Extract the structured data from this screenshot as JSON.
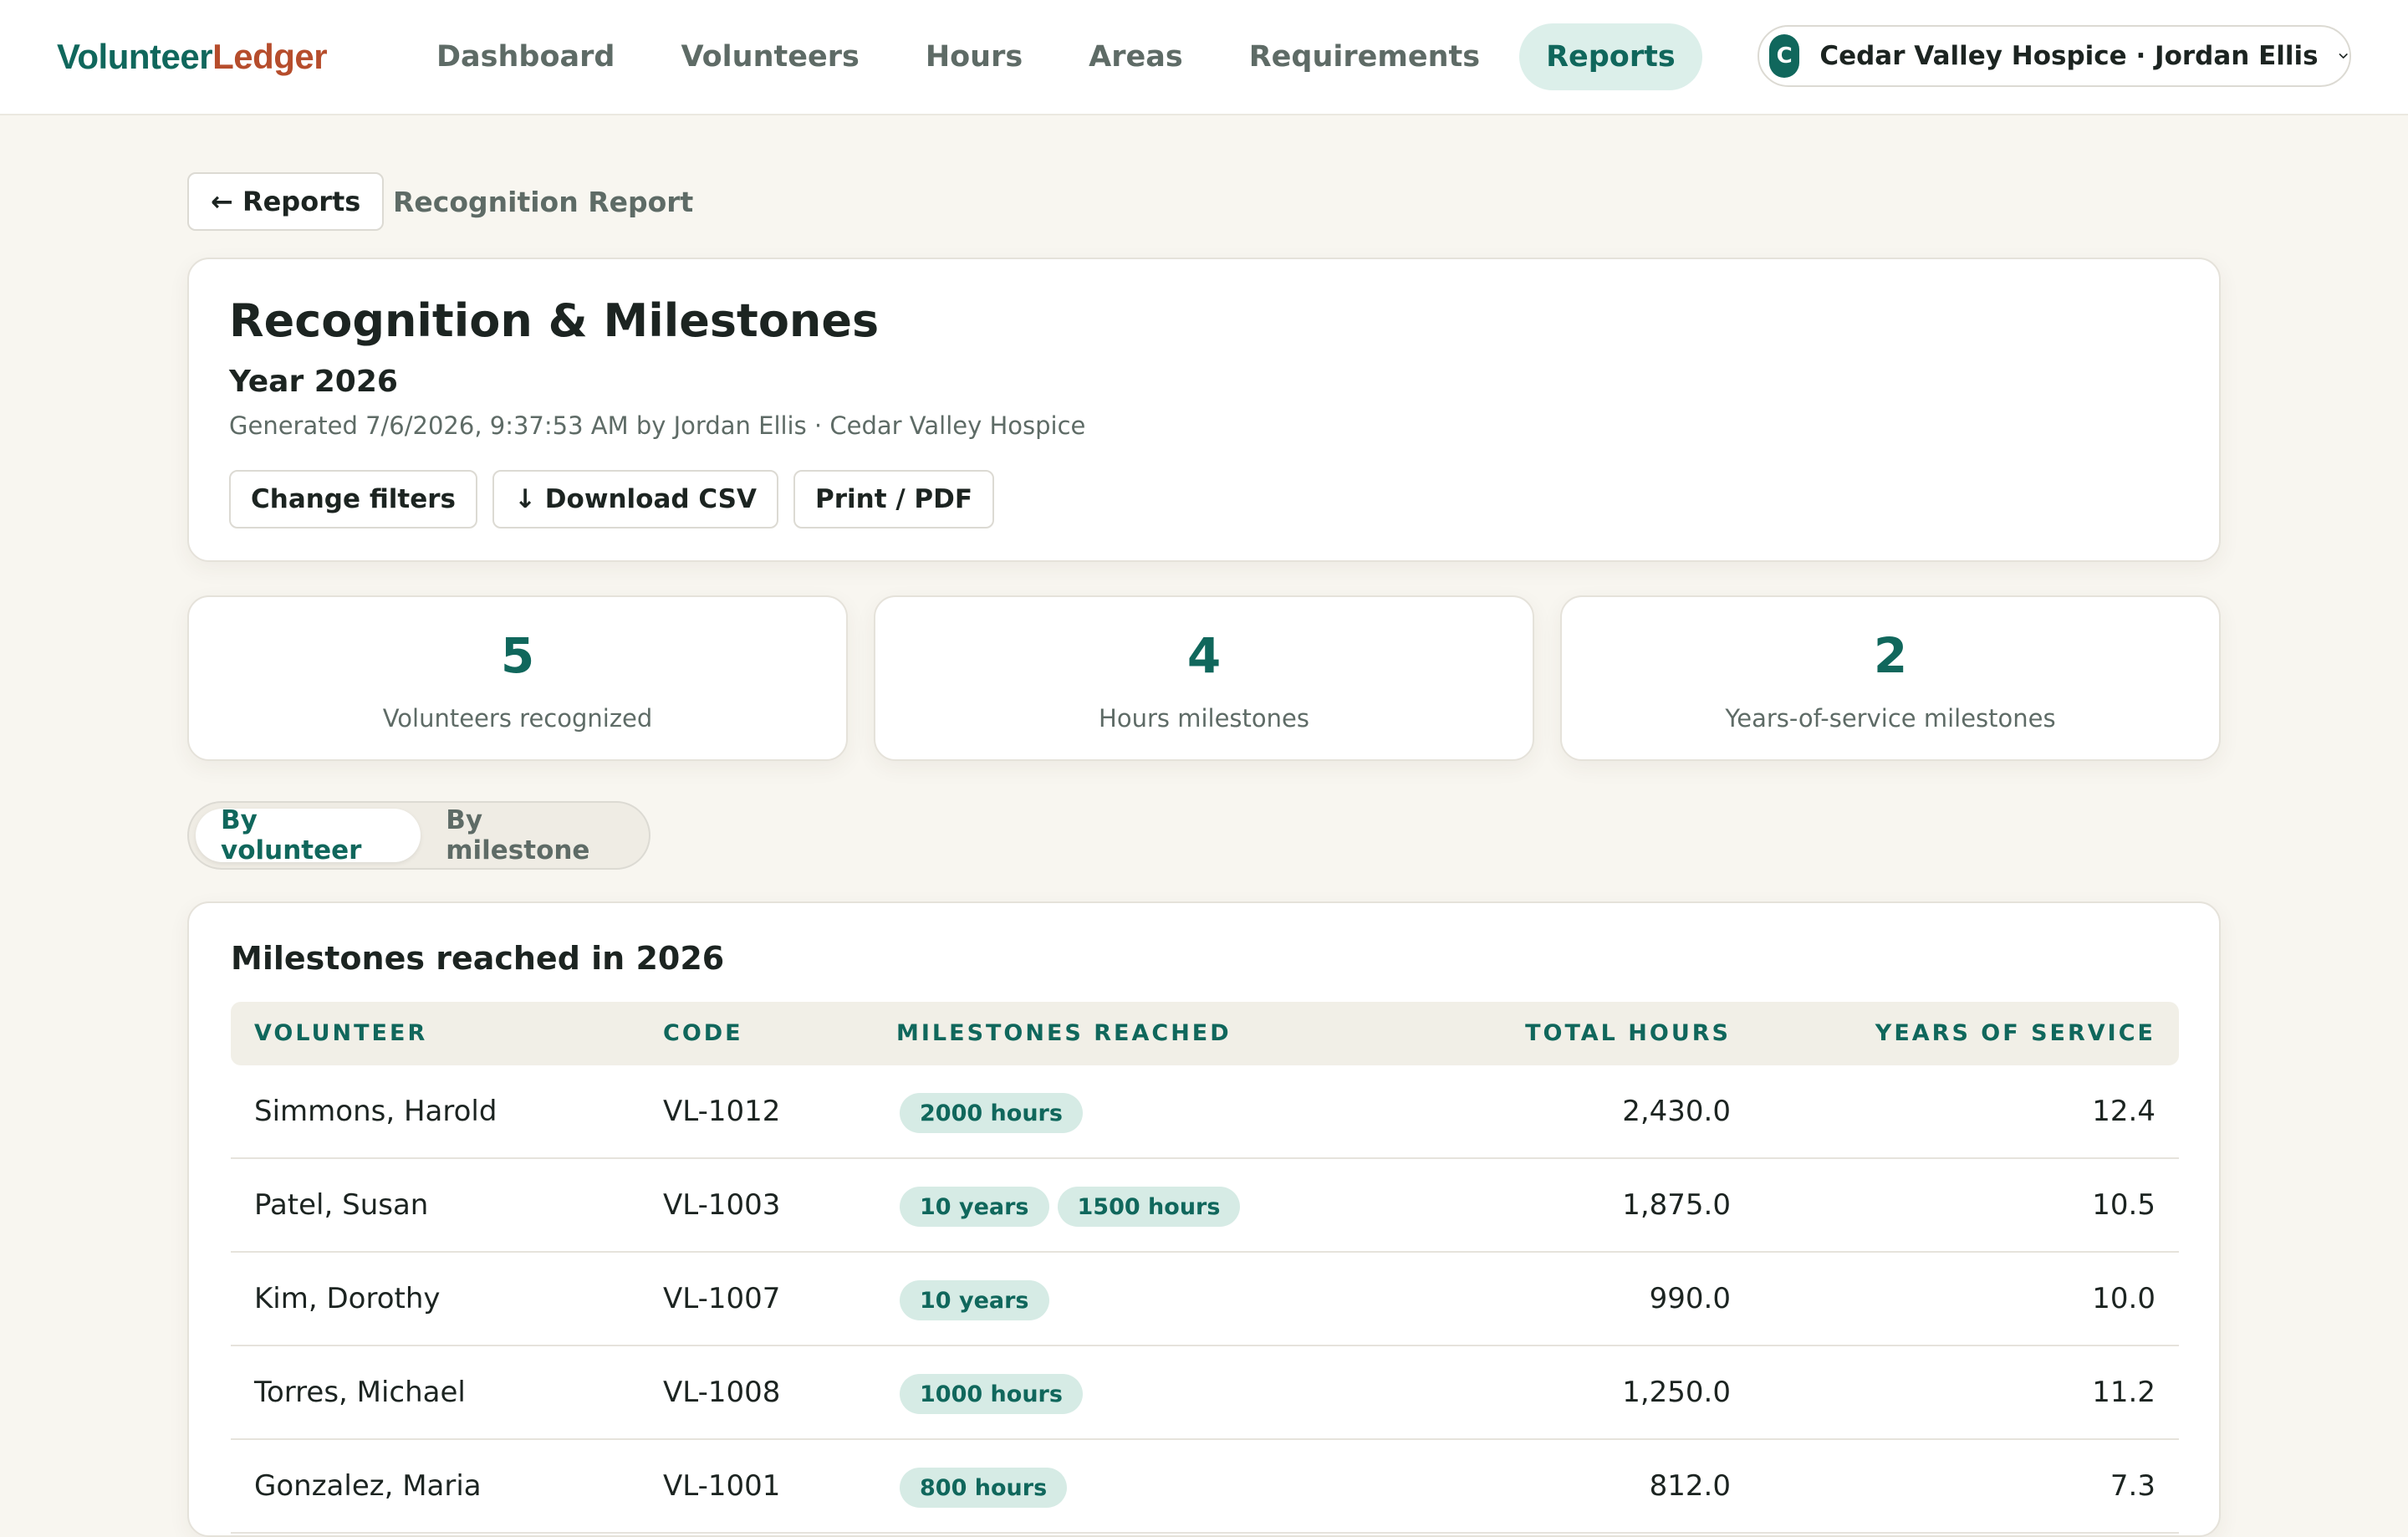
{
  "app": {
    "logo_part1": "Volunteer",
    "logo_part2": "Ledger",
    "brand_color": "#10675c",
    "accent_color": "#b64d2c"
  },
  "nav": {
    "items": [
      {
        "label": "Dashboard",
        "active": false
      },
      {
        "label": "Volunteers",
        "active": false
      },
      {
        "label": "Hours",
        "active": false
      },
      {
        "label": "Areas",
        "active": false
      },
      {
        "label": "Requirements",
        "active": false
      },
      {
        "label": "Reports",
        "active": true
      }
    ]
  },
  "account": {
    "initial": "C",
    "label": "Cedar Valley Hospice · Jordan Ellis"
  },
  "breadcrumb": {
    "back_label": "← Reports",
    "current": "Recognition Report"
  },
  "report": {
    "title": "Recognition & Milestones",
    "subtitle": "Year 2026",
    "generated": "Generated 7/6/2026, 9:37:53 AM by Jordan Ellis · Cedar Valley Hospice",
    "actions": {
      "change_filters": "Change filters",
      "download_csv": "↓ Download CSV",
      "print_pdf": "Print / PDF"
    }
  },
  "stats": [
    {
      "value": "5",
      "label": "Volunteers recognized"
    },
    {
      "value": "4",
      "label": "Hours milestones"
    },
    {
      "value": "2",
      "label": "Years-of-service milestones"
    }
  ],
  "view_toggle": {
    "by_volunteer": "By volunteer",
    "by_milestone": "By milestone",
    "selected": "By volunteer"
  },
  "table": {
    "title": "Milestones reached in 2026",
    "columns": {
      "volunteer": "VOLUNTEER",
      "code": "CODE",
      "milestones": "MILESTONES REACHED",
      "total_hours": "TOTAL HOURS",
      "years": "YEARS OF SERVICE"
    },
    "rows": [
      {
        "volunteer": "Simmons, Harold",
        "code": "VL-1012",
        "milestones": [
          "2000 hours"
        ],
        "total_hours": "2,430.0",
        "years": "12.4"
      },
      {
        "volunteer": "Patel, Susan",
        "code": "VL-1003",
        "milestones": [
          "10 years",
          "1500 hours"
        ],
        "total_hours": "1,875.0",
        "years": "10.5"
      },
      {
        "volunteer": "Kim, Dorothy",
        "code": "VL-1007",
        "milestones": [
          "10 years"
        ],
        "total_hours": "990.0",
        "years": "10.0"
      },
      {
        "volunteer": "Torres, Michael",
        "code": "VL-1008",
        "milestones": [
          "1000 hours"
        ],
        "total_hours": "1,250.0",
        "years": "11.2"
      },
      {
        "volunteer": "Gonzalez, Maria",
        "code": "VL-1001",
        "milestones": [
          "800 hours"
        ],
        "total_hours": "812.0",
        "years": "7.3"
      }
    ]
  }
}
